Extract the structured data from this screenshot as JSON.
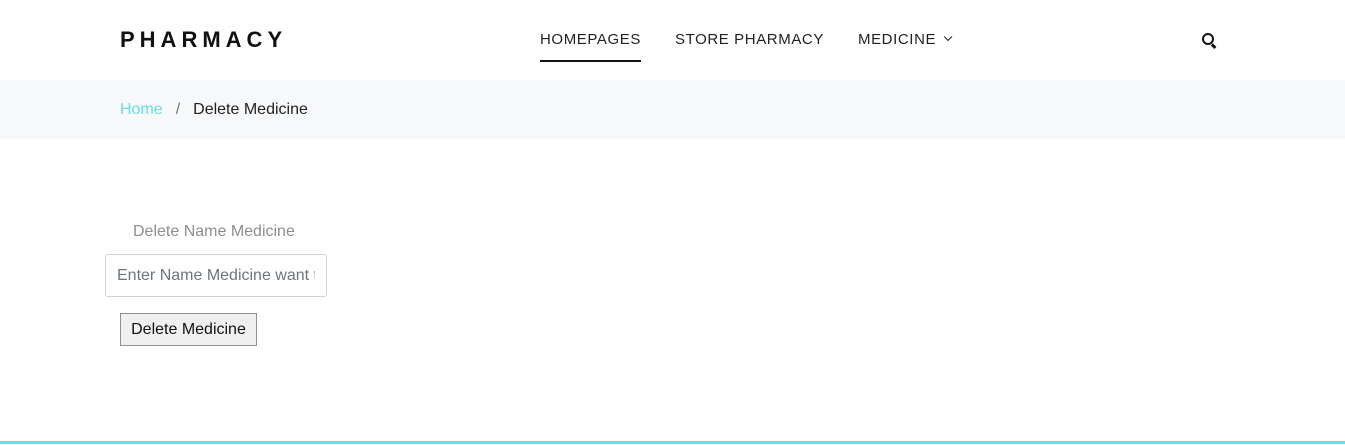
{
  "header": {
    "brand": "PHARMACY",
    "nav": [
      {
        "label": "HOMEPAGES",
        "active": true
      },
      {
        "label": "STORE PHARMACY",
        "active": false
      },
      {
        "label": "MEDICINE",
        "active": false,
        "has_dropdown": true
      }
    ],
    "search_icon": "search-icon"
  },
  "breadcrumb": {
    "home": "Home",
    "separator": "/",
    "current": "Delete Medicine"
  },
  "form": {
    "label": "Delete Name Medicine",
    "input_placeholder": "Enter Name Medicine want to delete",
    "input_value": "",
    "button_label": "Delete Medicine"
  },
  "colors": {
    "accent": "#66dfe0",
    "breadcrumb_bg": "#f7f8fa"
  }
}
